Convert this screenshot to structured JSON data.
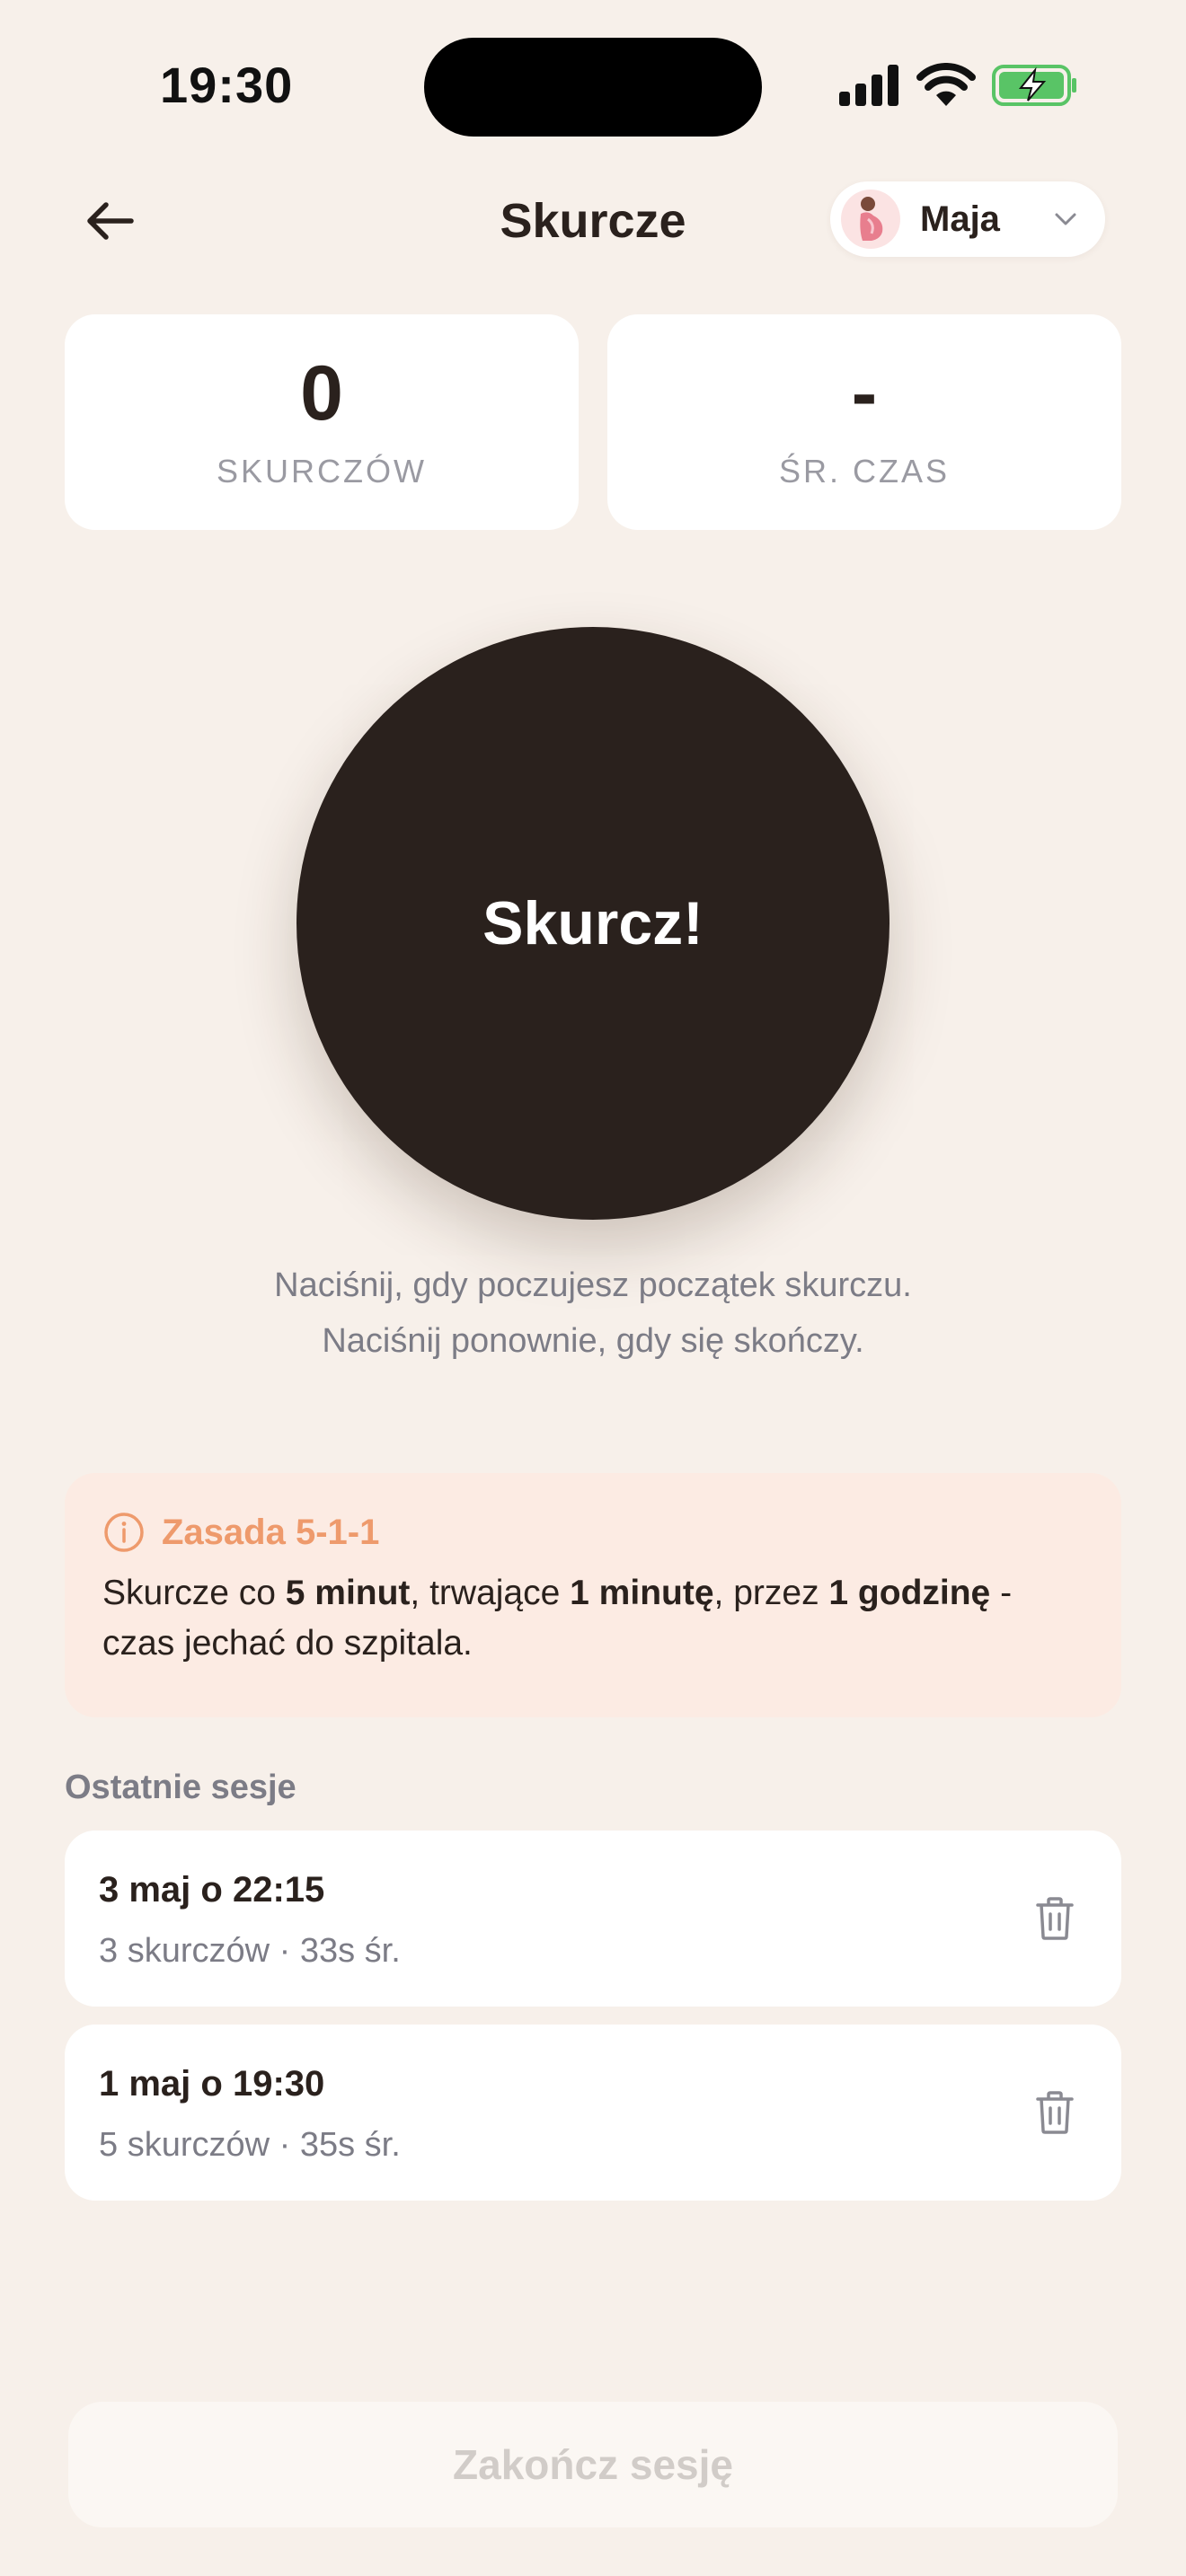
{
  "status_bar": {
    "time": "19:30"
  },
  "header": {
    "title": "Skurcze",
    "profile": {
      "name": "Maja"
    }
  },
  "stats": {
    "count": {
      "value": "0",
      "label": "SKURCZÓW"
    },
    "avg": {
      "value": "-",
      "label": "ŚR. CZAS"
    }
  },
  "main_button": {
    "label": "Skurcz!"
  },
  "instructions": {
    "line1": "Naciśnij, gdy poczujesz początek skurczu.",
    "line2": "Naciśnij ponownie, gdy się skończy."
  },
  "rule": {
    "title": "Zasada 5-1-1",
    "t1": "Skurcze co ",
    "b1": "5 minut",
    "t2": ", trwające ",
    "b2": "1 minutę",
    "t3": ", przez ",
    "b3": "1 godzinę",
    "t4": " - czas jechać do szpitala."
  },
  "sessions": {
    "heading": "Ostatnie sesje",
    "items": [
      {
        "date": "3 maj o 22:15",
        "summary": "3 skurczów · 33s śr."
      },
      {
        "date": "1 maj o 19:30",
        "summary": "5 skurczów · 35s śr."
      }
    ]
  },
  "footer": {
    "end_label": "Zakończ sesję"
  },
  "colors": {
    "background": "#F7F0EA",
    "primary_dark": "#2A211D",
    "accent_orange": "#EE9A6C",
    "info_bg": "#FCEBE3",
    "muted_text": "#7C7C86"
  }
}
